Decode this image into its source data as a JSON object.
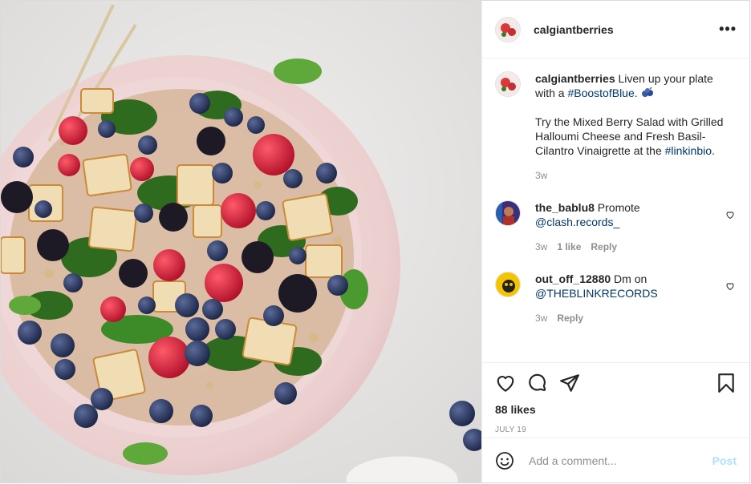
{
  "post": {
    "username": "calgiantberries",
    "more_label": "•••",
    "image_alt": "Mixed berry salad with grilled halloumi on a pink plate"
  },
  "caption": {
    "username": "calgiantberries",
    "text_1": " Liven up your plate with a ",
    "tag_1": "#BoostofBlue",
    "text_2": ". ",
    "emoji": "blueberries-emoji",
    "text_3": "Try the Mixed Berry Salad with Grilled Halloumi Cheese and Fresh Basil-Cilantro Vinaigrette at the ",
    "tag_2": "#linkinbio",
    "text_4": ".",
    "time": "3w"
  },
  "comments": [
    {
      "username": "the_bablu8",
      "text": " Promote",
      "mention": "@clash.records_",
      "time": "3w",
      "likes": "1 like",
      "reply": "Reply"
    },
    {
      "username": "out_off_12880",
      "text": " Dm on",
      "mention": "@THEBLINKRECORDS",
      "time": "3w",
      "reply": "Reply"
    }
  ],
  "actions": {
    "likes": "88 likes",
    "date": "JULY 19"
  },
  "add_comment": {
    "placeholder": "Add a comment...",
    "post_label": "Post"
  },
  "colors": {
    "link": "#00376b",
    "secondary": "#8e8e8e",
    "post_button_disabled": "#b2dffc"
  },
  "icons": [
    "more-icon",
    "heart-icon",
    "comment-icon",
    "share-icon",
    "bookmark-icon",
    "emoji-icon"
  ]
}
